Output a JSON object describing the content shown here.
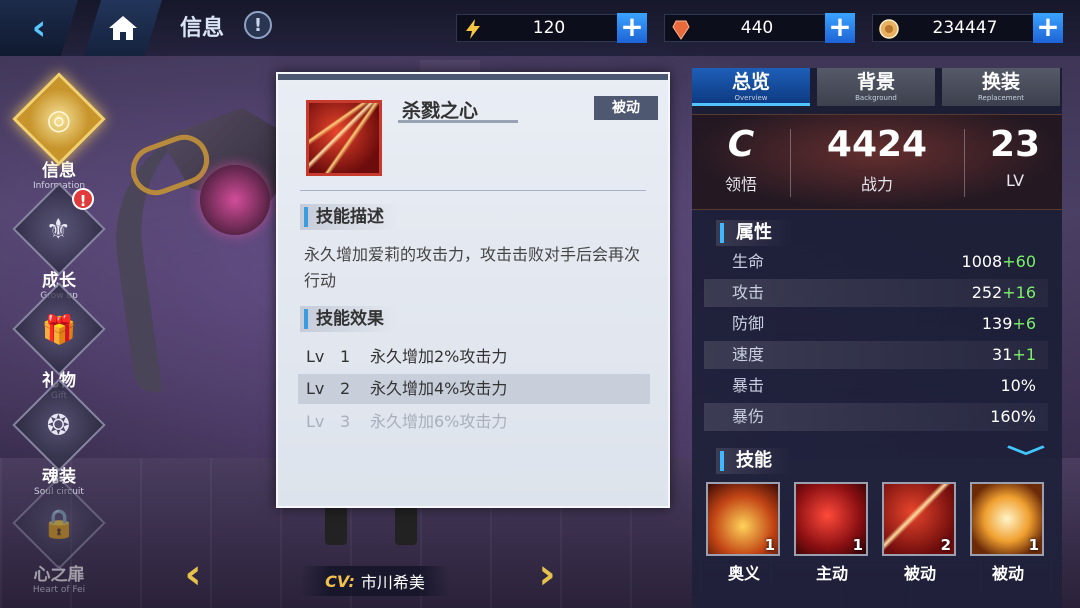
{
  "header": {
    "title": "信息",
    "info_badge": "!",
    "resources": [
      {
        "icon": "energy-icon",
        "value": "120",
        "color": "#f5c642"
      },
      {
        "icon": "crystal-icon",
        "value": "440",
        "color": "#e86a3c"
      },
      {
        "icon": "coin-icon",
        "value": "234447",
        "color": "#e8b060"
      }
    ],
    "plus": "+"
  },
  "nav": {
    "items": [
      {
        "label": "信息",
        "sub": "Information",
        "glyph": "◎",
        "active": true
      },
      {
        "label": "成长",
        "sub": "Grow up",
        "glyph": "⚜",
        "alert": "!"
      },
      {
        "label": "礼物",
        "sub": "Gift",
        "glyph": "🎁"
      },
      {
        "label": "魂装",
        "sub": "Soul circuit",
        "glyph": "❂"
      },
      {
        "label": "心之扉",
        "sub": "Heart of Fei",
        "glyph": "🔒"
      }
    ]
  },
  "footer": {
    "cv_tag": "CV:",
    "cv_name": "市川希美",
    "prev": "‹",
    "next": "›"
  },
  "skill_popup": {
    "name": "杀戮之心",
    "type_tag": "被动",
    "desc_header": "技能描述",
    "description": "永久增加爱莉的攻击力，攻击击败对手后会再次行动",
    "effect_header": "技能效果",
    "levels": [
      {
        "lv": "Lv",
        "n": "1",
        "text": "永久增加2%攻击力",
        "state": "normal"
      },
      {
        "lv": "Lv",
        "n": "2",
        "text": "永久增加4%攻击力",
        "state": "current"
      },
      {
        "lv": "Lv",
        "n": "3",
        "text": "永久增加6%攻击力",
        "state": "locked"
      }
    ]
  },
  "panel": {
    "tabs": [
      {
        "label": "总览",
        "sub": "Overview",
        "active": true
      },
      {
        "label": "背景",
        "sub": "Background"
      },
      {
        "label": "换装",
        "sub": "Replacement"
      }
    ],
    "stats": [
      {
        "value": "C",
        "label": "领悟"
      },
      {
        "value": "4424",
        "label": "战力"
      },
      {
        "value": "23",
        "label": "LV"
      }
    ],
    "attr_header": "属性",
    "attributes": [
      {
        "name": "生命",
        "base": "1008",
        "bonus": "+60"
      },
      {
        "name": "攻击",
        "base": "252",
        "bonus": "+16"
      },
      {
        "name": "防御",
        "base": "139",
        "bonus": "+6"
      },
      {
        "name": "速度",
        "base": "31",
        "bonus": "+1"
      },
      {
        "name": "暴击",
        "base": "10%",
        "bonus": ""
      },
      {
        "name": "暴伤",
        "base": "160%",
        "bonus": ""
      }
    ],
    "skill_header": "技能",
    "skills": [
      {
        "label": "奥义",
        "count": "1"
      },
      {
        "label": "主动",
        "count": "1"
      },
      {
        "label": "被动",
        "count": "2"
      },
      {
        "label": "被动",
        "count": "1"
      }
    ]
  }
}
